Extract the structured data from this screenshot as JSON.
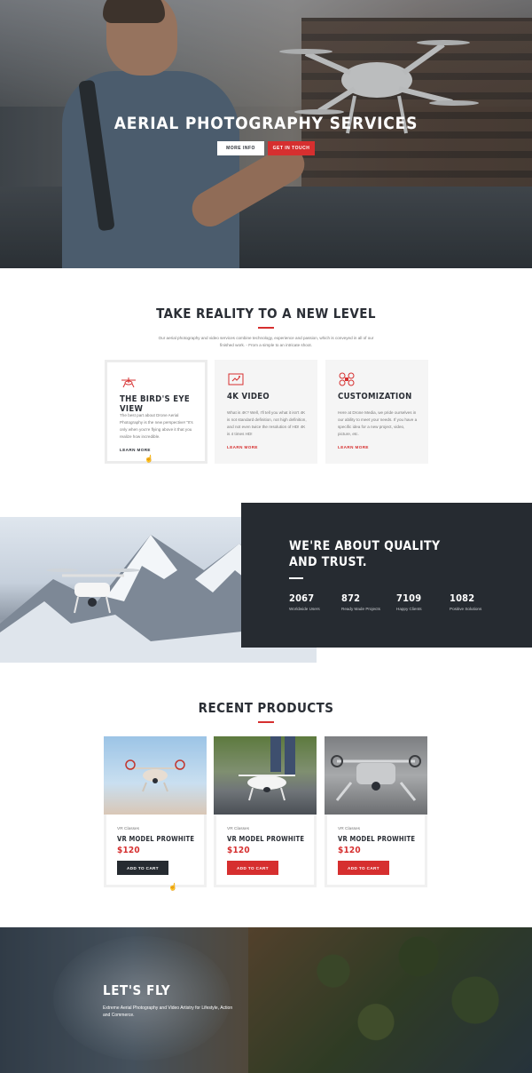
{
  "hero": {
    "title": "AERIAL PHOTOGRAPHY SERVICES",
    "btn_more": "MORE INFO",
    "btn_touch": "GET IN TOUCH"
  },
  "intro": {
    "title": "TAKE REALITY TO A NEW LEVEL",
    "text": "Our aerial photography and video services combine technology, experience and passion, which is conveyed in all of our finished work. - From a simple to an intricate shoot."
  },
  "features": [
    {
      "title": "THE BIRD'S EYE VIEW",
      "text": "The best part about Drone Aerial Photography is the new perspective! \"It's only when you're flying above it that you realize how incredible.",
      "link": "LEARN MORE",
      "icon": "drone-icon"
    },
    {
      "title": "4K VIDEO",
      "text": "What is 4K? Well, I'll tell you what it isn't 4K is not standard definition, not high definition, and not even twice the resolution of HD! 4K is 4 times HD!",
      "link": "LEARN MORE",
      "icon": "video-frame-icon"
    },
    {
      "title": "CUSTOMIZATION",
      "text": "Here at Drone Media, we pride ourselves in our ability to meet your needs. If you have a specific idea for a new project, video, picture, etc.",
      "link": "LEARN MORE",
      "icon": "quadcopter-icon"
    }
  ],
  "quality": {
    "title_line1": "WE'RE ABOUT QUALITY",
    "title_line2": "AND TRUST.",
    "stats": [
      {
        "num": "2067",
        "label": "Worldwide Users"
      },
      {
        "num": "872",
        "label": "Ready Made Projects"
      },
      {
        "num": "7109",
        "label": "Happy Clients"
      },
      {
        "num": "1082",
        "label": "Positive Solutions"
      }
    ]
  },
  "products": {
    "title": "RECENT PRODUCTS",
    "items": [
      {
        "category": "VR Classes",
        "name": "VR MODEL PROWHITE",
        "price": "$120",
        "cart": "ADD TO CART"
      },
      {
        "category": "VR Classes",
        "name": "VR MODEL PROWHITE",
        "price": "$120",
        "cart": "ADD TO CART"
      },
      {
        "category": "VR Classes",
        "name": "VR MODEL PROWHITE",
        "price": "$120",
        "cart": "ADD TO CART"
      }
    ]
  },
  "fly": {
    "title": "LET'S FLY",
    "text": "Extreme Aerial Photography and Video Artistry for Lifestyle, Action and Commerce."
  },
  "colors": {
    "accent": "#d62f2f",
    "dark": "#262b31"
  }
}
